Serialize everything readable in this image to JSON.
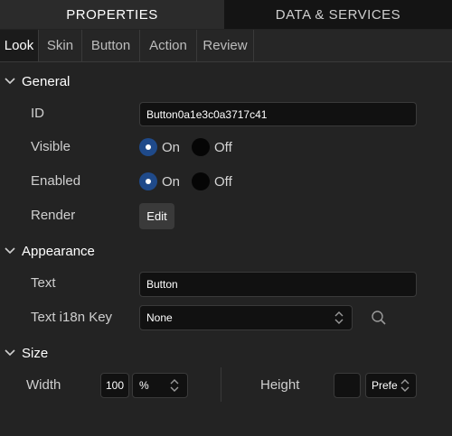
{
  "top_tabs": {
    "properties": "PROPERTIES",
    "data_services": "DATA & SERVICES"
  },
  "sub_tabs": [
    "Look",
    "Skin",
    "Button",
    "Action",
    "Review"
  ],
  "general": {
    "title": "General",
    "id_label": "ID",
    "id_value": "Button0a1e3c0a3717c41",
    "visible_label": "Visible",
    "enabled_label": "Enabled",
    "on_label": "On",
    "off_label": "Off",
    "render_label": "Render",
    "edit_label": "Edit"
  },
  "appearance": {
    "title": "Appearance",
    "text_label": "Text",
    "text_value": "Button",
    "i18n_label": "Text i18n Key",
    "i18n_value": "None"
  },
  "size": {
    "title": "Size",
    "width_label": "Width",
    "width_value": "100",
    "width_unit": "%",
    "height_label": "Height",
    "height_unit": "Prefe"
  },
  "colors": {
    "accent": "#1f4a8a",
    "background": "#232323",
    "field": "#111111"
  }
}
